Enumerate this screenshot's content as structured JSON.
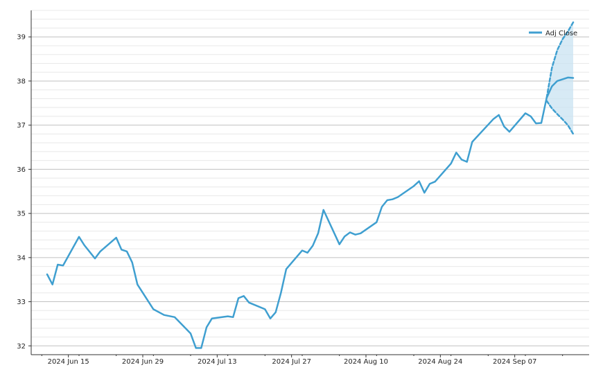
{
  "chart_data": {
    "type": "line",
    "title": "",
    "xlabel": "",
    "ylabel": "",
    "ylim": [
      31.8,
      39.6
    ],
    "x_ticks": [
      "2024-06-15",
      "2024-06-29",
      "2024-07-13",
      "2024-07-27",
      "2024-08-10",
      "2024-08-24",
      "2024-09-07"
    ],
    "x_tick_labels": [
      "2024 Jun 15",
      "2024 Jun 29",
      "2024 Jul 13",
      "2024 Jul 27",
      "2024 Aug 10",
      "2024 Aug 24",
      "2024 Sep 07"
    ],
    "y_ticks": [
      32,
      33,
      34,
      35,
      36,
      37,
      38,
      39
    ],
    "y_tick_labels": [
      "32",
      "33",
      "34",
      "35",
      "36",
      "37",
      "38",
      "39"
    ],
    "y_minor_step": 0.2,
    "grid": true,
    "legend": {
      "position": "top-right",
      "entries": [
        "Adj Close"
      ]
    },
    "colors": {
      "series": "#3f9fd0",
      "band": "#c9e3f2",
      "major_grid": "#c0c0c0",
      "minor_grid": "#e8e8e8",
      "axis": "#333333"
    },
    "series": [
      {
        "name": "Adj Close",
        "style": "solid",
        "x": [
          "2024-06-11",
          "2024-06-12",
          "2024-06-13",
          "2024-06-14",
          "2024-06-17",
          "2024-06-18",
          "2024-06-20",
          "2024-06-21",
          "2024-06-24",
          "2024-06-25",
          "2024-06-26",
          "2024-06-27",
          "2024-06-28",
          "2024-07-01",
          "2024-07-03",
          "2024-07-05",
          "2024-07-08",
          "2024-07-09",
          "2024-07-10",
          "2024-07-11",
          "2024-07-12",
          "2024-07-15",
          "2024-07-16",
          "2024-07-17",
          "2024-07-18",
          "2024-07-19",
          "2024-07-22",
          "2024-07-23",
          "2024-07-24",
          "2024-07-25",
          "2024-07-26",
          "2024-07-29",
          "2024-07-30",
          "2024-07-31",
          "2024-08-01",
          "2024-08-02",
          "2024-08-05",
          "2024-08-06",
          "2024-08-07",
          "2024-08-08",
          "2024-08-09",
          "2024-08-12",
          "2024-08-13",
          "2024-08-14",
          "2024-08-15",
          "2024-08-16",
          "2024-08-19",
          "2024-08-20",
          "2024-08-21",
          "2024-08-22",
          "2024-08-23",
          "2024-08-26",
          "2024-08-27",
          "2024-08-28",
          "2024-08-29",
          "2024-08-30",
          "2024-09-03",
          "2024-09-04",
          "2024-09-05",
          "2024-09-06",
          "2024-09-09",
          "2024-09-10",
          "2024-09-11",
          "2024-09-12",
          "2024-09-13"
        ],
        "values": [
          33.62,
          33.39,
          33.84,
          33.82,
          34.47,
          34.28,
          33.98,
          34.14,
          34.45,
          34.18,
          34.14,
          33.89,
          33.39,
          32.83,
          32.7,
          32.65,
          32.28,
          31.95,
          31.95,
          32.42,
          32.62,
          32.67,
          32.65,
          33.08,
          33.13,
          32.98,
          32.83,
          32.62,
          32.76,
          33.2,
          33.74,
          34.16,
          34.11,
          34.27,
          34.55,
          35.08,
          34.3,
          34.48,
          34.57,
          34.52,
          34.55,
          34.8,
          35.15,
          35.3,
          35.32,
          35.37,
          35.62,
          35.73,
          35.47,
          35.67,
          35.72,
          36.13,
          36.38,
          36.22,
          36.17,
          36.62,
          37.14,
          37.23,
          36.97,
          36.85,
          37.27,
          37.2,
          37.04,
          37.05,
          37.62
        ]
      },
      {
        "style": "solid",
        "x": [
          "2024-09-13",
          "2024-09-14",
          "2024-09-15",
          "2024-09-16",
          "2024-09-17",
          "2024-09-18"
        ],
        "values": [
          37.62,
          37.88,
          38.0,
          38.04,
          38.08,
          38.07
        ]
      },
      {
        "style": "dashed",
        "x": [
          "2024-09-13",
          "2024-09-14",
          "2024-09-15",
          "2024-09-16",
          "2024-09-17",
          "2024-09-18"
        ],
        "values": [
          37.62,
          38.3,
          38.7,
          38.95,
          39.12,
          39.33
        ]
      },
      {
        "style": "dashed",
        "x": [
          "2024-09-13",
          "2024-09-14",
          "2024-09-15",
          "2024-09-16",
          "2024-09-17",
          "2024-09-18"
        ],
        "values": [
          37.55,
          37.38,
          37.25,
          37.13,
          37.0,
          36.8
        ]
      }
    ],
    "band": {
      "x": [
        "2024-09-13",
        "2024-09-14",
        "2024-09-15",
        "2024-09-16",
        "2024-09-17",
        "2024-09-18"
      ],
      "upper": [
        37.62,
        38.3,
        38.7,
        38.95,
        39.12,
        39.33
      ],
      "lower": [
        37.55,
        37.38,
        37.25,
        37.13,
        37.0,
        36.8
      ]
    }
  }
}
